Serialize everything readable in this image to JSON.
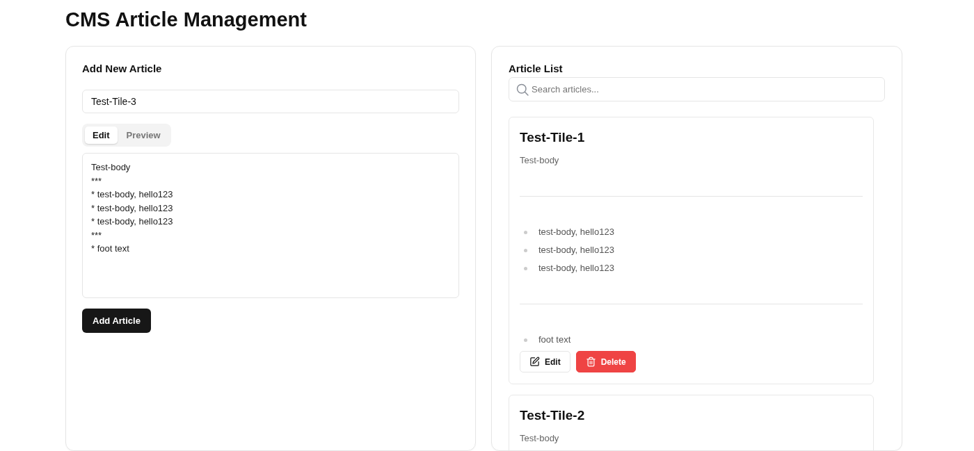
{
  "page_title": "CMS Article Management",
  "editor": {
    "heading": "Add New Article",
    "title_value": "Test-Tile-3",
    "tabs": [
      {
        "label": "Edit",
        "selected": true
      },
      {
        "label": "Preview",
        "selected": false
      }
    ],
    "body_value": "Test-body\n***\n* test-body, hello123\n* test-body, hello123\n* test-body, hello123\n***\n* foot text",
    "submit": "Add Article"
  },
  "list": {
    "heading": "Article List",
    "search": {
      "placeholder": "Search articles..."
    },
    "articles": [
      {
        "title": "Test-Tile-1",
        "blocks": [
          {
            "kind": "paragraph",
            "text": "Test-body"
          },
          {
            "kind": "rule"
          },
          {
            "kind": "list",
            "items": [
              "test-body, hello123",
              "test-body, hello123",
              "test-body, hello123"
            ]
          },
          {
            "kind": "rule"
          },
          {
            "kind": "list",
            "items": [
              "foot text"
            ]
          }
        ],
        "actions": [
          {
            "kind": "edit",
            "label": "Edit"
          },
          {
            "kind": "delete",
            "label": "Delete"
          }
        ]
      },
      {
        "title": "Test-Tile-2",
        "blocks": [
          {
            "kind": "paragraph",
            "text": "Test-body"
          }
        ]
      }
    ]
  }
}
